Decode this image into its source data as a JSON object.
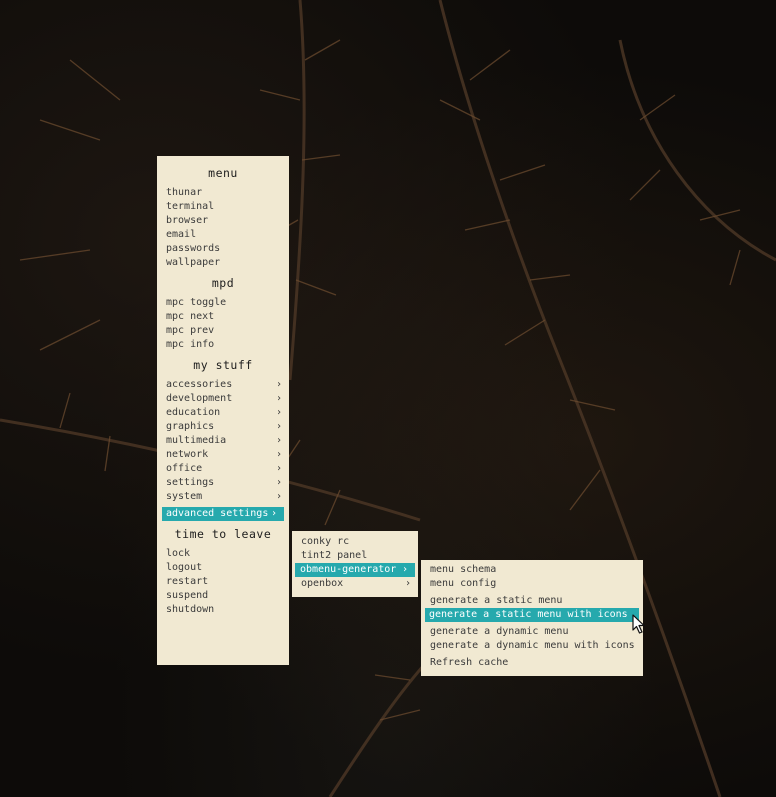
{
  "main_menu": {
    "title": "menu",
    "apps": [
      "thunar",
      "terminal",
      "browser",
      "email",
      "passwords",
      "wallpaper"
    ],
    "mpd_title": "mpd",
    "mpd_items": [
      "mpc toggle",
      "mpc next",
      "mpc prev",
      "mpc info"
    ],
    "mystuff_title": "my stuff",
    "categories": [
      "accessories",
      "development",
      "education",
      "graphics",
      "multimedia",
      "network",
      "office",
      "settings",
      "system"
    ],
    "advanced": "advanced settings",
    "leave_title": "time to leave",
    "leave_items": [
      "lock",
      "logout",
      "restart",
      "suspend",
      "shutdown"
    ]
  },
  "advanced_menu": {
    "items": [
      "conky rc",
      "tint2 panel",
      "obmenu-generator",
      "openbox"
    ]
  },
  "obmenu_menu": {
    "items": [
      "menu schema",
      "menu config"
    ],
    "generate_items": [
      "generate a static menu",
      "generate a static menu with icons"
    ],
    "dynamic_items": [
      "generate a dynamic menu",
      "generate a dynamic menu with icons"
    ],
    "refresh": "Refresh cache"
  },
  "submenu_arrow": "›",
  "colors": {
    "menu_bg": "#f1e9d2",
    "highlight": "#26a9ad",
    "text": "#3b3b3b"
  },
  "icons": {
    "submenu_indicator": "chevron-right-icon",
    "pointer": "mouse-pointer-icon"
  }
}
